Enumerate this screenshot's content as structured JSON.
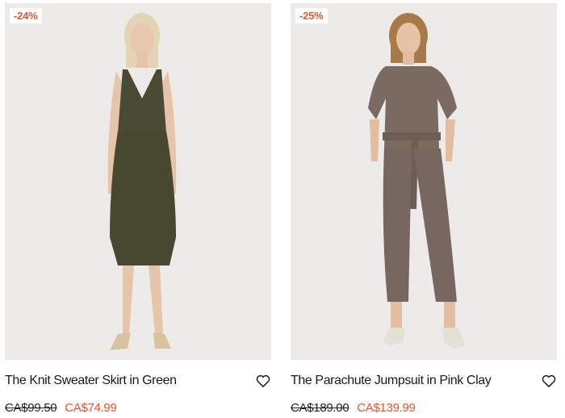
{
  "products": [
    {
      "discount_badge": "-24%",
      "title": "The Knit Sweater Skirt in Green",
      "original_price": "CA$99.50",
      "sale_price": "CA$74.99",
      "image_desc_color": "#4a4b34"
    },
    {
      "discount_badge": "-25%",
      "title": "The Parachute Jumpsuit in Pink Clay",
      "original_price": "CA$189.00",
      "sale_price": "CA$139.99",
      "image_desc_color": "#7a6a60"
    }
  ],
  "icons": {
    "wishlist": "heart-outline-icon"
  },
  "colors": {
    "accent_sale": "#e8552d",
    "text": "#1a1a1a",
    "photo_bg": "#ecebe9"
  }
}
